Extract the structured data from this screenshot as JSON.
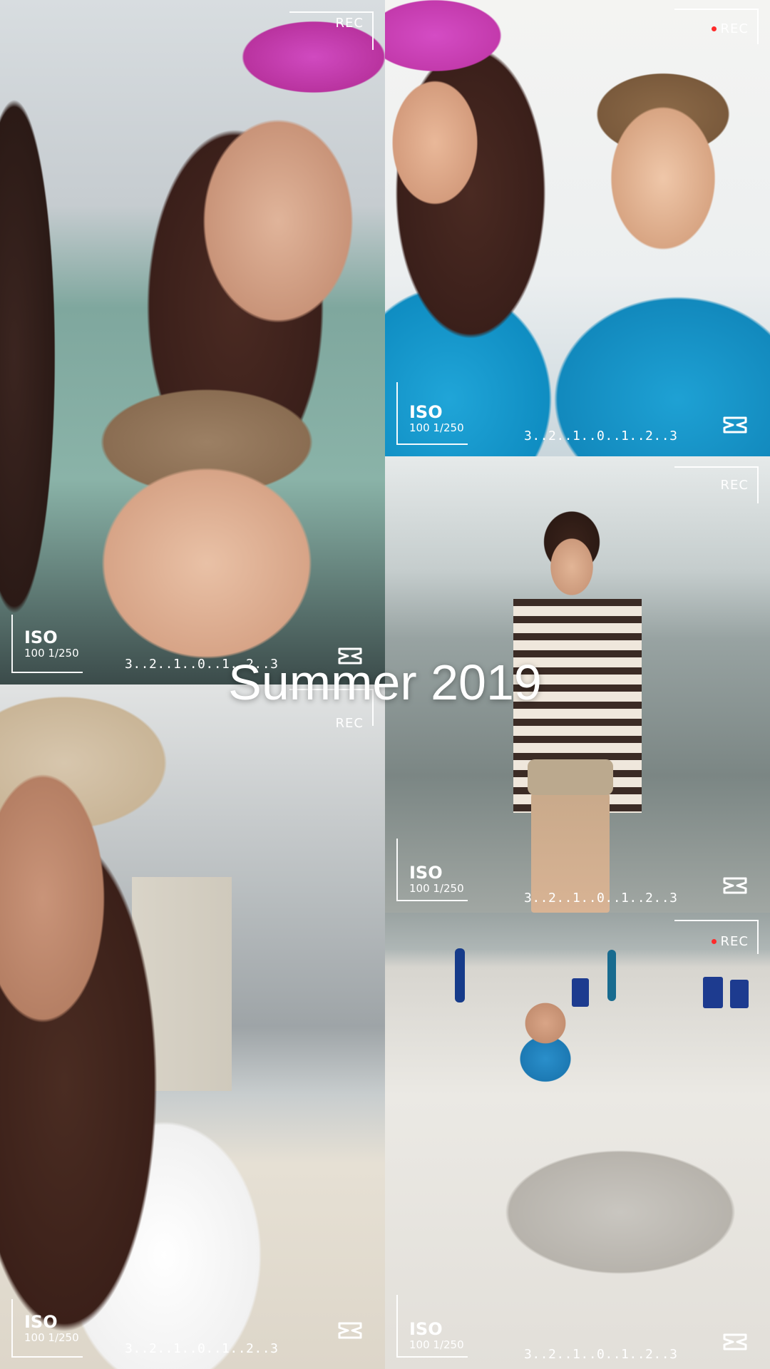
{
  "title": "Summer 2019",
  "tiles": [
    {
      "id": "tile-1",
      "scene": "indoor selfie with woman in pink cap and smiling boy",
      "rec_label": "REC",
      "rec_dot": false,
      "iso_label": "ISO",
      "iso_value": "100 1/250",
      "exposure_scale": "3..2..1..0..1..2..3"
    },
    {
      "id": "tile-2",
      "scene": "beach selfie with woman in pink cap and boy with glasses",
      "rec_label": "REC",
      "rec_dot": true,
      "iso_label": "ISO",
      "iso_value": "100 1/250",
      "exposure_scale": "3..2..1..0..1..2..3"
    },
    {
      "id": "tile-3",
      "scene": "girl in striped shirt walking in ocean waves",
      "rec_label": "REC",
      "rec_dot": false,
      "iso_label": "ISO",
      "iso_value": "100 1/250",
      "exposure_scale": "3..2..1..0..1..2..3"
    },
    {
      "id": "tile-4",
      "scene": "woman in tan cap selfie on beach with high-rise building",
      "rec_label": "REC",
      "rec_dot": false,
      "iso_label": "ISO",
      "iso_value": "100 1/250",
      "exposure_scale": "3..2..1..0..1..2..3"
    },
    {
      "id": "tile-5",
      "scene": "boy building sandcastle on white sand beach with chairs and umbrellas",
      "rec_label": "REC",
      "rec_dot": true,
      "iso_label": "ISO",
      "iso_value": "100 1/250",
      "exposure_scale": "3..2..1..0..1..2..3"
    }
  ],
  "icons": {
    "capcut": "capcut-logo-icon"
  },
  "colors": {
    "overlay_text": "#ffffff",
    "rec_dot": "#ff2a2a"
  }
}
